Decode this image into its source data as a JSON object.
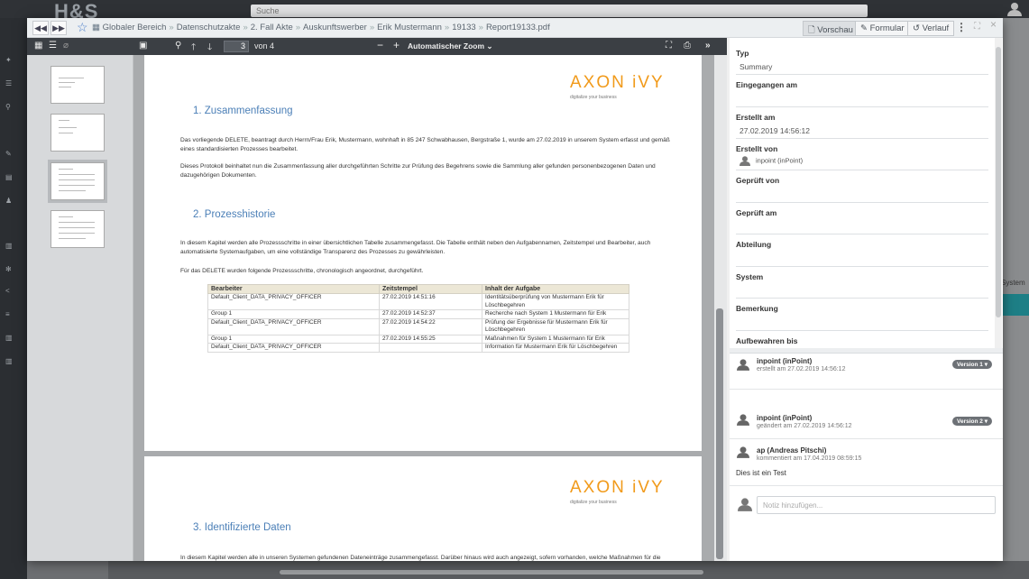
{
  "background": {
    "logo": "H&S",
    "search_placeholder": "Suche",
    "system_label": "System"
  },
  "topbar": {
    "breadcrumbs": [
      "Globaler Bereich",
      "Datenschutzakte",
      "2. Fall Akte",
      "Auskunftswerber",
      "Erik Mustermann",
      "19133",
      "Report19133.pdf"
    ],
    "buttons": {
      "preview": "Vorschau",
      "form": "Formular",
      "history": "Verlauf"
    }
  },
  "pdf_toolbar": {
    "current_page": "3",
    "page_of": "von 4",
    "zoom": "Automatischer Zoom"
  },
  "document": {
    "logo_text": "AXON",
    "logo_accent": "iVY",
    "tagline": "digitalize your business",
    "section1_title": "1.  Zusammenfassung",
    "section1_p1": "Das vorliegende DELETE, beantragt durch Herrn/Frau Erik, Mustermann, wohnhaft in 85 247 Schwabhausen, Bergstraße 1,  wurde am  27.02.2019 in unserem System erfasst und gemäß eines standardisierten Prozesses bearbeitet.",
    "section1_p2": "Dieses Protokoll beinhaltet nun die Zusammenfassung aller durchgeführten Schritte zur Prüfung des Begehrens sowie die Sammlung aller gefunden personenbezogenen Daten und dazugehörigen Dokumenten.",
    "section2_title": "2.  Prozesshistorie",
    "section2_p1": "In diesem Kapitel werden alle Prozessschritte in einer übersichtlichen Tabelle zusammengefasst. Die Tabelle enthält neben den Aufgabennamen, Zeitstempel und Bearbeiter, auch automatisierte Systemaufgaben, um eine vollständige Transparenz des Prozesses zu gewährleisten.",
    "section2_p2": "Für das DELETE wurden folgende Prozessschritte, chronologisch angeordnet, durchgeführt.",
    "table_headers": [
      "Bearbeiter",
      "Zeitstempel",
      "Inhalt der Aufgabe"
    ],
    "table_rows": [
      [
        "Default_Client_DATA_PRIVACY_OFFICER",
        "27.02.2019 14:51:16",
        "Identitätsüberprüfung von Mustermann Erik für Löschbegehren"
      ],
      [
        "Group 1",
        "27.02.2019 14:52:37",
        "Recherche nach System 1 Mustermann für Erik"
      ],
      [
        "Default_Client_DATA_PRIVACY_OFFICER",
        "27.02.2019 14:54:22",
        "Prüfung der Ergebnisse für Mustermann Erik für Löschbegehren"
      ],
      [
        "Group 1",
        "27.02.2019 14:55:25",
        "Maßnahmen für System 1 Mustermann für Erik"
      ],
      [
        "Default_Client_DATA_PRIVACY_OFFICER",
        "",
        "Information für Mustermann Erik für Löschbegehren"
      ]
    ],
    "section3_title": "3.  Identifizierte Daten",
    "section3_p1": "In diesem Kapitel werden alle in unseren Systemen gefundenen Dateneinträge zusammengefasst. Darüber hinaus wird auch angezeigt, sofern vorhanden, welche Maßnahmen für die einzelnen Einträge durchgeführt wurden."
  },
  "form": {
    "typ_label": "Typ",
    "typ_value": "Summary",
    "eingegangen_label": "Eingegangen am",
    "erstellt_am_label": "Erstellt am",
    "erstellt_am_value": "27.02.2019 14:56:12",
    "erstellt_von_label": "Erstellt von",
    "erstellt_von_value": "inpoint (inPoint)",
    "geprueft_von_label": "Geprüft von",
    "geprueft_am_label": "Geprüft am",
    "abteilung_label": "Abteilung",
    "system_label": "System",
    "bemerkung_label": "Bemerkung",
    "aufbewahren_label": "Aufbewahren bis"
  },
  "history": [
    {
      "name": "inpoint (inPoint)",
      "meta": "erstellt am 27.02.2019 14:56:12",
      "badge": "Version 1"
    },
    {
      "name": "inpoint (inPoint)",
      "meta": "geändert am 27.02.2019 14:56:12",
      "badge": "Version 2"
    },
    {
      "name": "ap (Andreas Pitschi)",
      "meta": "kommentiert am 17.04.2019 08:59:15",
      "comment": "Dies ist ein Test"
    }
  ],
  "comment_placeholder": "Notiz hinzufügen..."
}
